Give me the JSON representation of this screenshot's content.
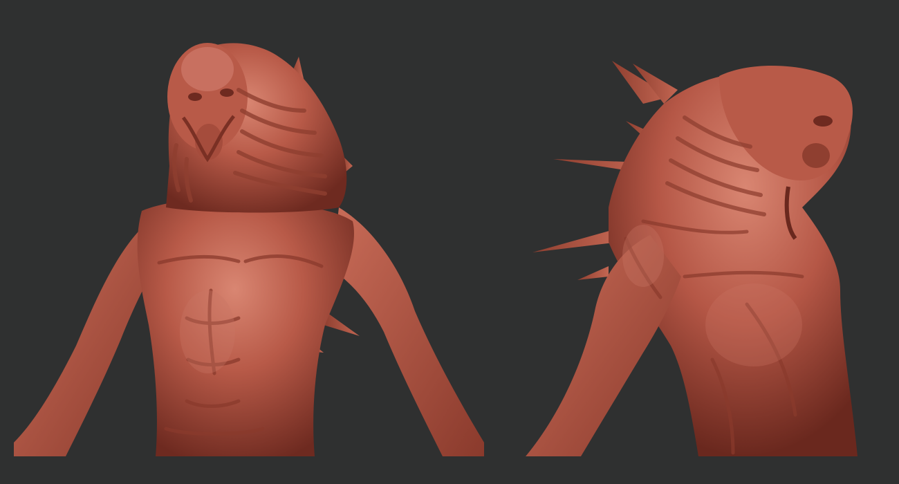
{
  "canvas": {
    "background_color": "#2f3030"
  },
  "renders": [
    {
      "view": "front",
      "subject": "creature-bust-sculpt",
      "material_color": "#b85a48",
      "highlight_color": "#d98672",
      "shadow_color": "#6e2a20"
    },
    {
      "view": "three-quarter-side",
      "subject": "creature-bust-sculpt",
      "material_color": "#b85a48",
      "highlight_color": "#d98672",
      "shadow_color": "#6e2a20"
    }
  ]
}
